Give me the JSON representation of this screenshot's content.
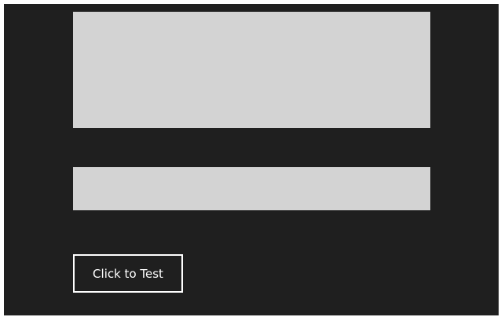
{
  "window": {
    "background": "#1f1f1f"
  },
  "multiline_text_area": {
    "value": "",
    "background": "#d3d3d3"
  },
  "single_line_text_box": {
    "value": "",
    "background": "#d3d3d3"
  },
  "test_button": {
    "label": "Click to Test",
    "border_color": "#ffffff"
  }
}
